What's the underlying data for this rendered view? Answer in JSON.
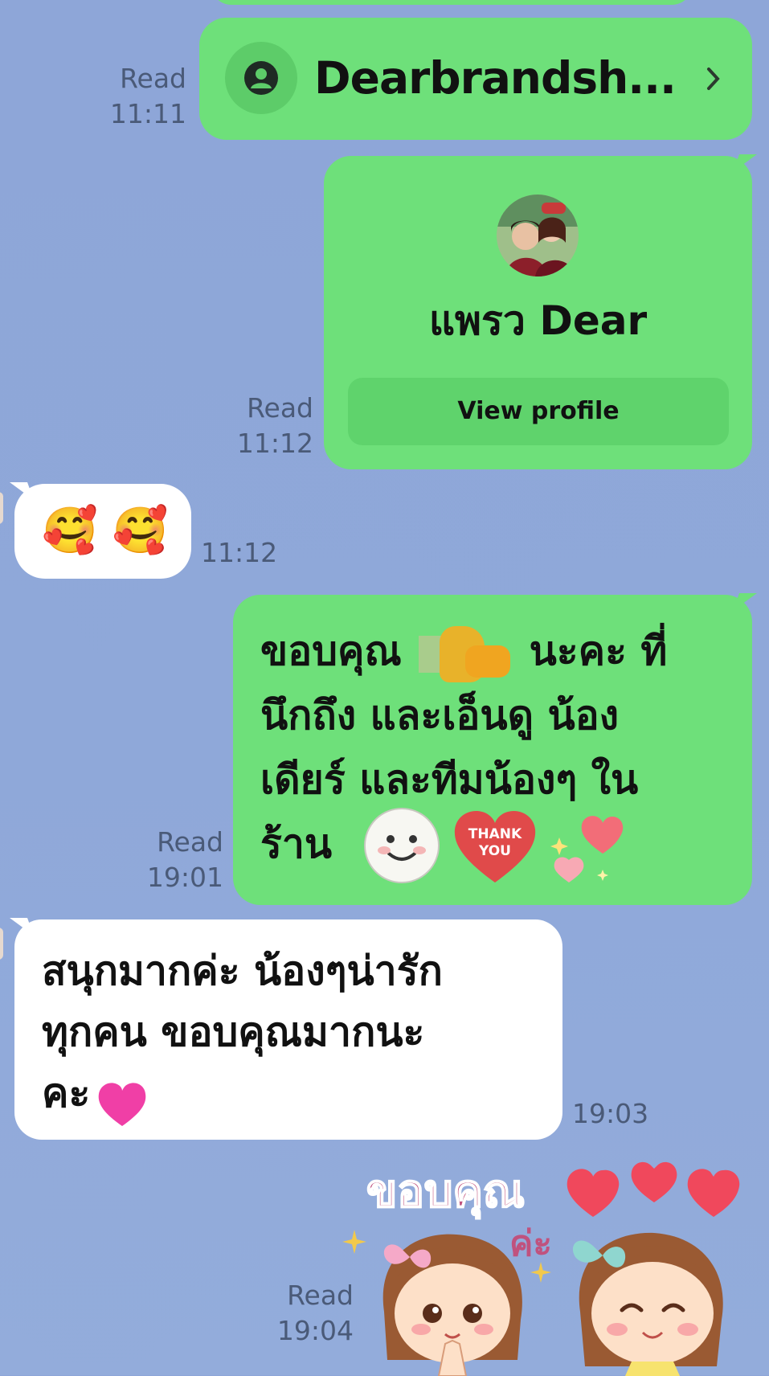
{
  "messages": {
    "link_card": {
      "title": "Dearbrandsh...",
      "read_label": "Read",
      "time": "11:11"
    },
    "profile_card": {
      "name": "แพรว Dear",
      "button_label": "View profile",
      "read_label": "Read",
      "time": "11:12"
    },
    "emoji_message": {
      "content": "🥰 🥰",
      "time": "11:12"
    },
    "thanks_message": {
      "line1": "ขอบคุณ",
      "line1_end": "นะคะ ที่",
      "line2": "นึกถึง และเอ็นดู น้อง",
      "line3": "เดียร์ และทีมน้องๆ ใน",
      "line4": "ร้าน",
      "sticker_text": "THANK YOU",
      "read_label": "Read",
      "time": "19:01"
    },
    "reply_message": {
      "line1": "สนุกมากค่ะ น้องๆน่ารัก",
      "line2": "ทุกคน ขอบคุณมากนะ",
      "line3": "คะ",
      "time": "19:03"
    },
    "sticker_message": {
      "sticker_text_1": "ขอบคุณ",
      "sticker_text_2": "ค่ะ",
      "read_label": "Read",
      "time": "19:04"
    }
  },
  "colors": {
    "background": "#8fa8d9",
    "sent_bubble": "#6ee07a",
    "received_bubble": "#ffffff",
    "meta_text": "#4a5a78"
  }
}
